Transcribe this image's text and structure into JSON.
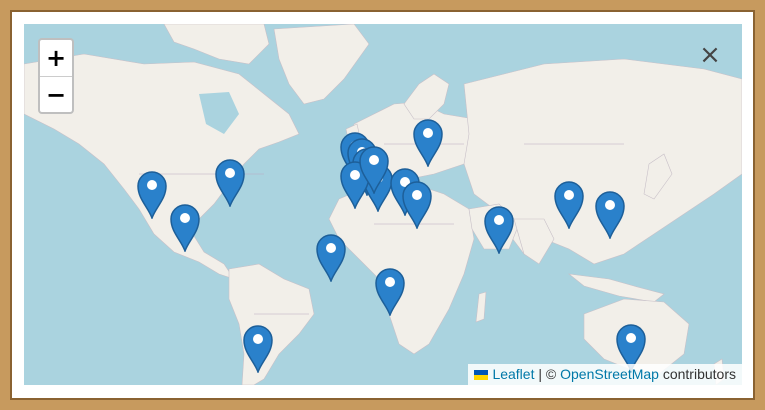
{
  "map": {
    "zoom_in_label": "+",
    "zoom_out_label": "−",
    "close_label": "×",
    "attribution": {
      "leaflet": "Leaflet",
      "separator": "| ©",
      "osm": "OpenStreetMap",
      "suffix": "contributors"
    },
    "colors": {
      "water": "#aad3df",
      "land": "#f2efe9",
      "marker": "#2a81cb",
      "border": "#c79a5e"
    },
    "markers": [
      {
        "name": "marker-north-1"
      },
      {
        "name": "marker-north-2"
      },
      {
        "name": "marker-north-3"
      },
      {
        "name": "marker-north-4"
      },
      {
        "name": "marker-north-5"
      },
      {
        "name": "marker-north-6"
      },
      {
        "name": "marker-north-7"
      },
      {
        "name": "marker-north-8"
      },
      {
        "name": "marker-north-9"
      },
      {
        "name": "marker-north-10"
      },
      {
        "name": "marker-north-11"
      },
      {
        "name": "marker-north-12"
      },
      {
        "name": "marker-north-13"
      },
      {
        "name": "marker-north-14"
      },
      {
        "name": "marker-north-15"
      },
      {
        "name": "marker-north-16"
      },
      {
        "name": "marker-north-17"
      },
      {
        "name": "marker-north-18"
      },
      {
        "name": "marker-north-19"
      }
    ]
  }
}
